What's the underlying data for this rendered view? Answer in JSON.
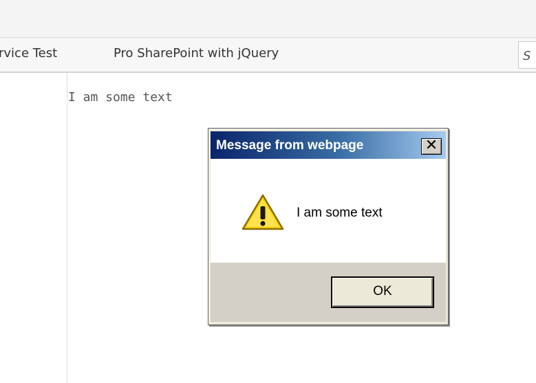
{
  "nav": {
    "items": [
      "rvice Test",
      "Pro SharePoint with jQuery"
    ],
    "search_partial": "S"
  },
  "page": {
    "text": "I am some text"
  },
  "dialog": {
    "title": "Message from webpage",
    "close_glyph": "✕",
    "message": "I am some text",
    "ok_label": "OK",
    "icon": "warning-icon"
  },
  "colors": {
    "title_gradient_start": "#0a246a",
    "title_gradient_end": "#a6caf0",
    "warning_yellow": "#ffd400"
  }
}
